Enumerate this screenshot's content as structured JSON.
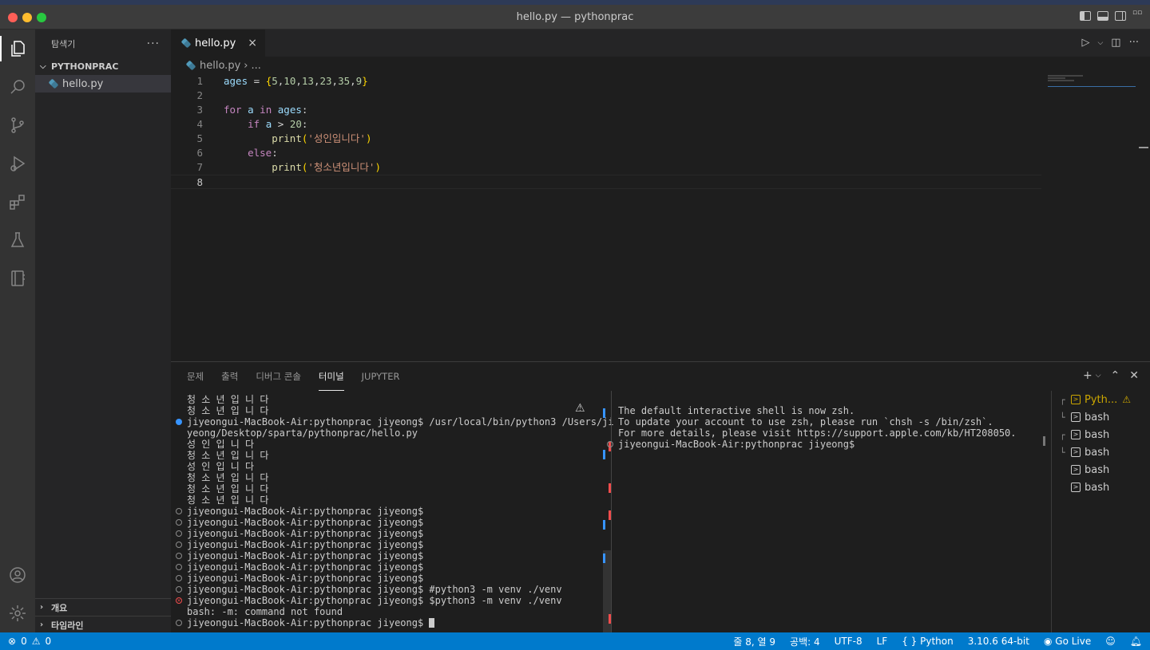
{
  "window": {
    "title": "hello.py — pythonprac"
  },
  "sidebar": {
    "title": "탐색기",
    "more": "···",
    "folder": "PYTHONPRAC",
    "files": [
      "hello.py"
    ],
    "outline": "개요",
    "timeline": "타임라인"
  },
  "editor": {
    "tab_label": "hello.py",
    "breadcrumb_file": "hello.py",
    "breadcrumb_rest": "...",
    "current_line": 8,
    "lines": [
      "ages = {5,10,13,23,35,9}",
      "",
      "for a in ages:",
      "    if a > 20:",
      "        print('성인입니다')",
      "    else:",
      "        print('청소년입니다')",
      ""
    ]
  },
  "panel": {
    "tabs": [
      "문제",
      "출력",
      "디버그 콘솔",
      "터미널",
      "JUPYTER"
    ],
    "active_tab": "터미널",
    "terminal_left": [
      {
        "text": "청 소 년 입 니 다",
        "deco": ""
      },
      {
        "text": "청 소 년 입 니 다",
        "deco": ""
      },
      {
        "text": "jiyeongui-MacBook-Air:pythonprac jiyeong$ /usr/local/bin/python3 /Users/ji",
        "deco": "blue"
      },
      {
        "text": "yeong/Desktop/sparta/pythonprac/hello.py",
        "deco": ""
      },
      {
        "text": "성 인 입 니 다",
        "deco": ""
      },
      {
        "text": "청 소 년 입 니 다",
        "deco": ""
      },
      {
        "text": "성 인 입 니 다",
        "deco": ""
      },
      {
        "text": "청 소 년 입 니 다",
        "deco": ""
      },
      {
        "text": "청 소 년 입 니 다",
        "deco": ""
      },
      {
        "text": "청 소 년 입 니 다",
        "deco": ""
      },
      {
        "text": "jiyeongui-MacBook-Air:pythonprac jiyeong$",
        "deco": "hollow"
      },
      {
        "text": "jiyeongui-MacBook-Air:pythonprac jiyeong$",
        "deco": "hollow"
      },
      {
        "text": "jiyeongui-MacBook-Air:pythonprac jiyeong$",
        "deco": "hollow"
      },
      {
        "text": "jiyeongui-MacBook-Air:pythonprac jiyeong$",
        "deco": "hollow"
      },
      {
        "text": "jiyeongui-MacBook-Air:pythonprac jiyeong$",
        "deco": "hollow"
      },
      {
        "text": "jiyeongui-MacBook-Air:pythonprac jiyeong$",
        "deco": "hollow"
      },
      {
        "text": "jiyeongui-MacBook-Air:pythonprac jiyeong$",
        "deco": "hollow"
      },
      {
        "text": "jiyeongui-MacBook-Air:pythonprac jiyeong$ #python3 -m venv ./venv",
        "deco": "hollow"
      },
      {
        "text": "jiyeongui-MacBook-Air:pythonprac jiyeong$ $python3 -m venv ./venv",
        "deco": "err"
      },
      {
        "text": "bash: -m: command not found",
        "deco": ""
      },
      {
        "text": "jiyeongui-MacBook-Air:pythonprac jiyeong$ ",
        "deco": "hollow",
        "cursor": true
      }
    ],
    "terminal_right": [
      {
        "text": "",
        "deco": ""
      },
      {
        "text": "The default interactive shell is now zsh.",
        "deco": ""
      },
      {
        "text": "To update your account to use zsh, please run `chsh -s /bin/zsh`.",
        "deco": ""
      },
      {
        "text": "For more details, please visit https://support.apple.com/kb/HT208050.",
        "deco": ""
      },
      {
        "text": "jiyeongui-MacBook-Air:pythonprac jiyeong$",
        "deco": "hollow"
      }
    ],
    "terminal_list": [
      {
        "label": "Pyth...",
        "tree": "┌",
        "active": true,
        "warn": true
      },
      {
        "label": "bash",
        "tree": "└",
        "active": false,
        "warn": false
      },
      {
        "label": "bash",
        "tree": "┌",
        "active": false,
        "warn": false
      },
      {
        "label": "bash",
        "tree": "└",
        "active": false,
        "warn": false
      },
      {
        "label": "bash",
        "tree": "",
        "active": false,
        "warn": false
      },
      {
        "label": "bash",
        "tree": "",
        "active": false,
        "warn": false
      }
    ]
  },
  "statusbar": {
    "errors": "0",
    "warnings": "0",
    "position": "줄 8, 열 9",
    "spaces": "공백: 4",
    "encoding": "UTF-8",
    "eol": "LF",
    "language": "Python",
    "interpreter": "3.10.6 64-bit",
    "golive": "Go Live"
  },
  "colors": {
    "accent": "#007acc",
    "background": "#1e1e1e",
    "sidebar": "#252526",
    "activitybar": "#333333"
  }
}
